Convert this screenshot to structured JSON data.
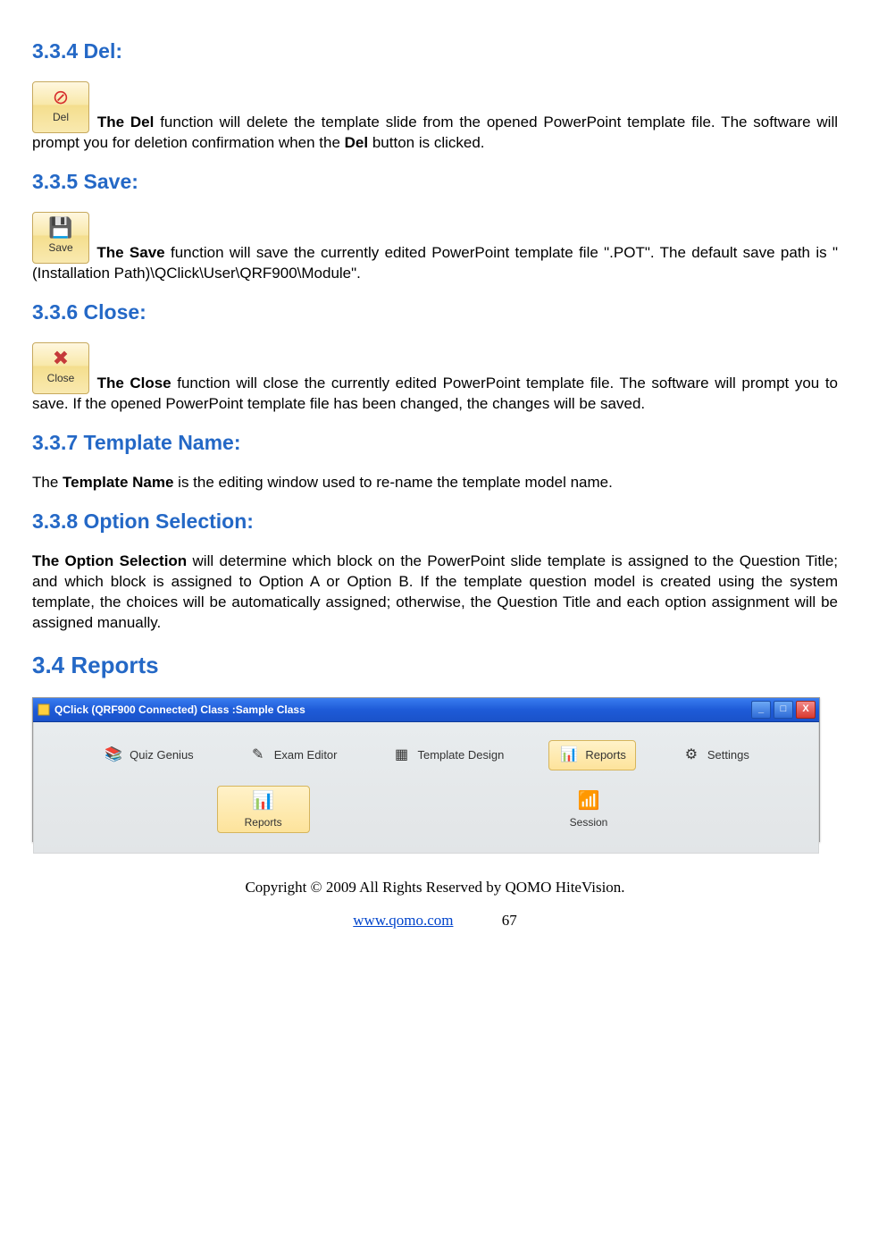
{
  "sections": {
    "del": {
      "heading": "3.3.4 Del:",
      "icon_label": "Del",
      "text_prefix": "The Del",
      "text_body": " function will delete the template slide from the opened PowerPoint template file. The software will prompt you for deletion confirmation when the ",
      "text_bold_mid": "Del",
      "text_tail": " button is clicked."
    },
    "save": {
      "heading": "3.3.5 Save:",
      "icon_label": "Save",
      "text_prefix": "The Save",
      "text_body": " function will save the currently edited PowerPoint template file \".POT\". The default save path is \"(Installation Path)\\QClick\\User\\QRF900\\Module\"."
    },
    "close": {
      "heading": "3.3.6 Close:",
      "icon_label": "Close",
      "text_prefix": "The Close",
      "text_body": " function will close the currently edited PowerPoint template file. The software will prompt you to save. If the opened PowerPoint template file has been changed, the changes will be saved."
    },
    "template_name": {
      "heading": "3.3.7 Template Name:",
      "text_prefix": "Template Name",
      "text_lead": "The ",
      "text_body": " is the editing window used to re-name the template model name."
    },
    "option_selection": {
      "heading": "3.3.8 Option Selection:",
      "text_prefix": "The Option Selection",
      "text_body": " will determine which block on the PowerPoint slide template is assigned to the Question Title; and which block is assigned to Option A or Option B. If  the template question model is created using the system template, the choices will be automatically assigned; otherwise, the Question Title and each option assignment will be assigned manually."
    },
    "reports": {
      "heading": "3.4  Reports"
    }
  },
  "screenshot": {
    "title": "QClick  (QRF900 Connected)  Class :Sample Class",
    "row1": [
      {
        "label": "Quiz Genius",
        "icon": "📚",
        "selected": false
      },
      {
        "label": "Exam Editor",
        "icon": "✎",
        "selected": false
      },
      {
        "label": "Template Design",
        "icon": "▦",
        "selected": false
      },
      {
        "label": "Reports",
        "icon": "📊",
        "selected": true
      },
      {
        "label": "Settings",
        "icon": "⚙",
        "selected": false
      }
    ],
    "row2": [
      {
        "label": "Reports",
        "icon": "📊",
        "selected": true
      },
      {
        "label": "Session",
        "icon": "📶",
        "selected": false
      }
    ],
    "window_buttons": {
      "min": "_",
      "max": "□",
      "close": "X"
    }
  },
  "footer": {
    "copyright": "Copyright © 2009 All Rights Reserved by QOMO HiteVision.",
    "url": "www.qomo.com",
    "page": "67"
  }
}
